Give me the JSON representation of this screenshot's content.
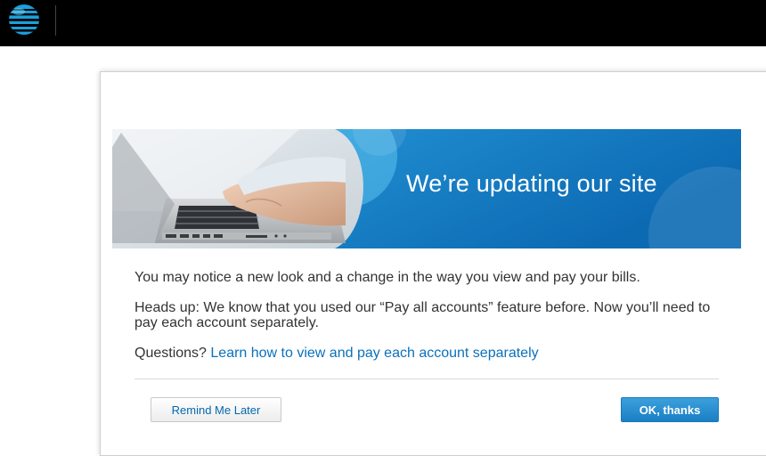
{
  "header": {
    "brand": "AT&T"
  },
  "modal": {
    "banner_title": "We’re updating our site",
    "message_1": "You may notice a new look and a change in the way you view and pay your bills.",
    "message_2": "Heads up: We know that you used our “Pay all accounts” feature before. Now you’ll need to pay each account separately.",
    "questions_prefix": "Questions?",
    "questions_link": "Learn how to view and pay each account separately",
    "remind_button": "Remind Me Later",
    "ok_button": "OK, thanks"
  },
  "colors": {
    "header_bg": "#000000",
    "brand_blue": "#0a71bb",
    "banner_blue": "#1583c9",
    "primary_button": "#2a8fd0"
  },
  "icons": {
    "logo": "att-globe-icon"
  }
}
